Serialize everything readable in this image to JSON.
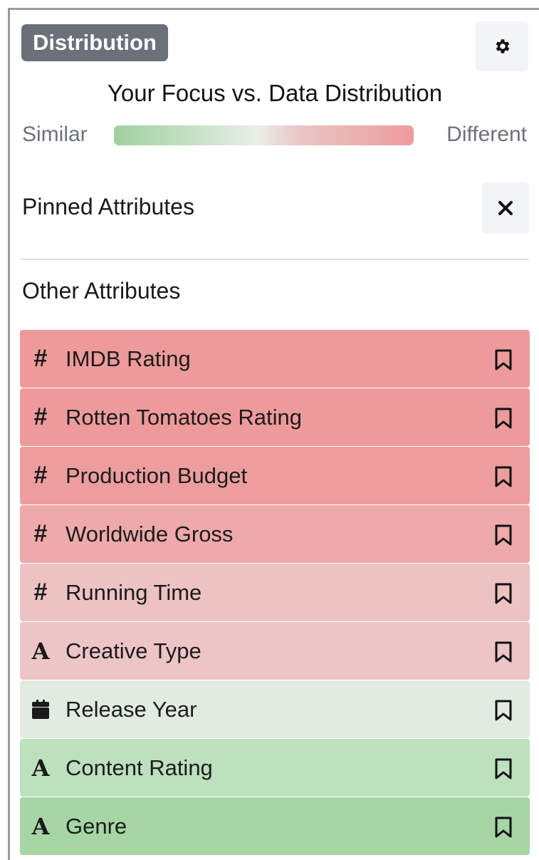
{
  "header": {
    "badge_label": "Distribution",
    "settings_icon": "gear-icon"
  },
  "legend": {
    "title": "Your Focus vs. Data Distribution",
    "left_label": "Similar",
    "right_label": "Different",
    "colors": {
      "similar": "#9fd09e",
      "neutral": "#e9eee8",
      "different": "#ec9b9d"
    }
  },
  "pinned": {
    "title": "Pinned Attributes",
    "clear_icon": "close-icon"
  },
  "other": {
    "title": "Other Attributes",
    "items": [
      {
        "label": "IMDB Rating",
        "type": "quantitative",
        "icon": "#",
        "color": "#ee9a9b"
      },
      {
        "label": "Rotten Tomatoes Rating",
        "type": "quantitative",
        "icon": "#",
        "color": "#ee9a9b"
      },
      {
        "label": "Production Budget",
        "type": "quantitative",
        "icon": "#",
        "color": "#ee9d9e"
      },
      {
        "label": "Worldwide Gross",
        "type": "quantitative",
        "icon": "#",
        "color": "#eea9aa"
      },
      {
        "label": "Running Time",
        "type": "quantitative",
        "icon": "#",
        "color": "#edc2c3"
      },
      {
        "label": "Creative Type",
        "type": "nominal",
        "icon": "A",
        "color": "#edc5c6"
      },
      {
        "label": "Release Year",
        "type": "temporal",
        "icon": "calendar-icon",
        "color": "#e2ebe1"
      },
      {
        "label": "Content Rating",
        "type": "nominal",
        "icon": "A",
        "color": "#bde0bd"
      },
      {
        "label": "Genre",
        "type": "nominal",
        "icon": "A",
        "color": "#a5d6a4"
      }
    ]
  }
}
